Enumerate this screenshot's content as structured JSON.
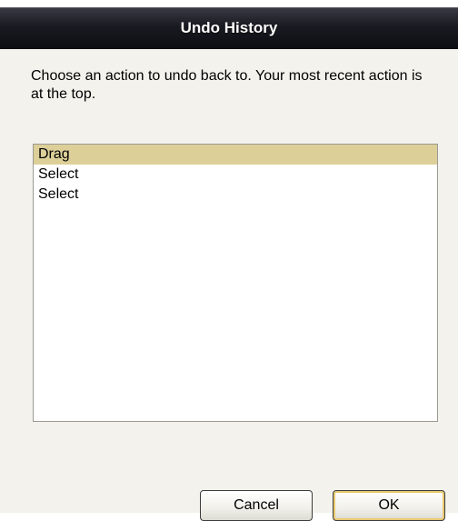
{
  "window": {
    "title": "Undo History"
  },
  "dialog": {
    "instructions": "Choose an action to undo back to. Your most recent action is at the top."
  },
  "history": {
    "items": [
      {
        "label": "Drag",
        "selected": true
      },
      {
        "label": "Select",
        "selected": false
      },
      {
        "label": "Select",
        "selected": false
      }
    ]
  },
  "buttons": {
    "cancel_label": "Cancel",
    "ok_label": "OK"
  },
  "colors": {
    "selection": "#dccf98",
    "titlebar": "#1a1a22",
    "dialog_bg": "#f3f2ec",
    "default_button_focus": "#e8c870"
  }
}
